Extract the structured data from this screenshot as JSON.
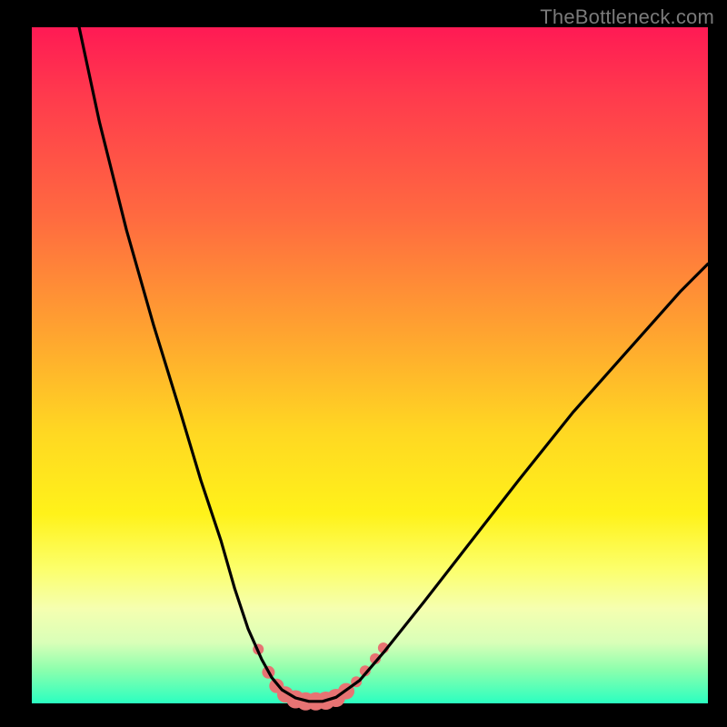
{
  "watermark": "TheBottleneck.com",
  "colors": {
    "frame": "#000000",
    "curve": "#000000",
    "markers": "#e77373",
    "watermark": "#7a7a7a"
  },
  "chart_data": {
    "type": "line",
    "title": "",
    "xlabel": "",
    "ylabel": "",
    "xlim": [
      0,
      100
    ],
    "ylim": [
      0,
      100
    ],
    "grid": false,
    "legend": false,
    "note": "V-shaped bottleneck curve; y is mismatch percentage (0 = optimal). No axis tick labels shown. Values estimated from pixel positions.",
    "series": [
      {
        "name": "bottleneck-curve",
        "x": [
          7,
          10,
          14,
          18,
          22,
          25,
          28,
          30,
          32,
          34,
          35.5,
          37,
          39,
          41,
          43,
          45,
          48.5,
          52,
          58,
          65,
          72,
          80,
          88,
          96,
          100
        ],
        "y": [
          100,
          86,
          70,
          56,
          43,
          33,
          24,
          17,
          11,
          6.5,
          3.8,
          2,
          0.8,
          0.3,
          0.3,
          0.9,
          3.4,
          7.5,
          15,
          24,
          33,
          43,
          52,
          61,
          65
        ]
      }
    ],
    "markers": {
      "name": "highlighted-points",
      "note": "Salmon dots on/near the valley floor; visually varied sizes.",
      "points": [
        {
          "x": 33.5,
          "y": 8.0,
          "r": 6
        },
        {
          "x": 35.0,
          "y": 4.6,
          "r": 7
        },
        {
          "x": 36.2,
          "y": 2.6,
          "r": 8
        },
        {
          "x": 37.5,
          "y": 1.3,
          "r": 9
        },
        {
          "x": 39.0,
          "y": 0.6,
          "r": 10
        },
        {
          "x": 40.5,
          "y": 0.3,
          "r": 10
        },
        {
          "x": 42.0,
          "y": 0.3,
          "r": 10
        },
        {
          "x": 43.5,
          "y": 0.4,
          "r": 10
        },
        {
          "x": 45.0,
          "y": 0.8,
          "r": 10
        },
        {
          "x": 46.5,
          "y": 1.8,
          "r": 9
        },
        {
          "x": 48.0,
          "y": 3.2,
          "r": 6
        },
        {
          "x": 49.3,
          "y": 4.8,
          "r": 6
        },
        {
          "x": 50.8,
          "y": 6.6,
          "r": 6
        },
        {
          "x": 52.0,
          "y": 8.2,
          "r": 6
        }
      ]
    }
  }
}
